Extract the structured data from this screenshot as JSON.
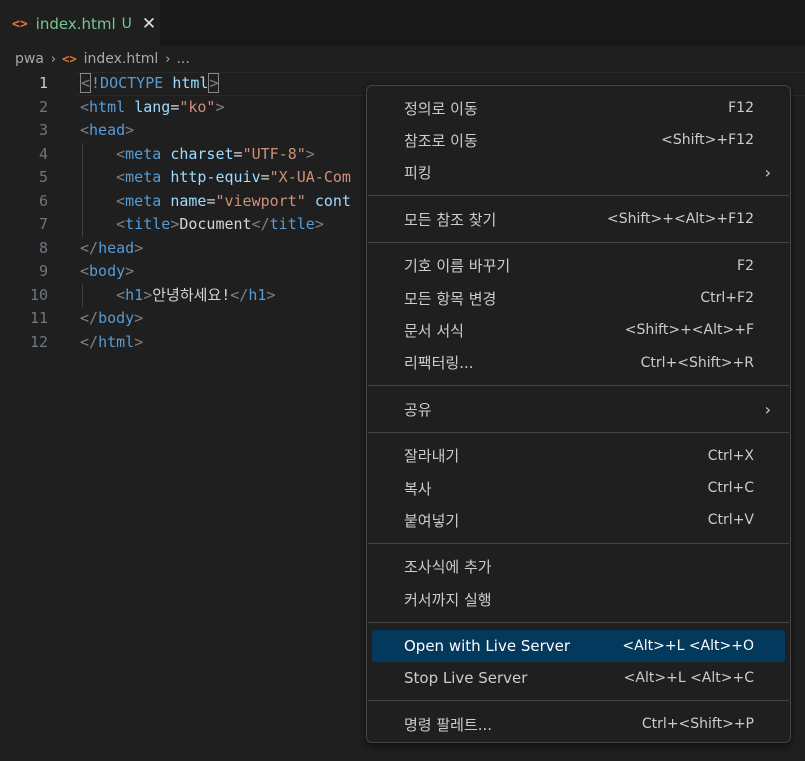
{
  "tab": {
    "title": "index.html",
    "status": "U",
    "close": "✕",
    "file_icon": "<>"
  },
  "breadcrumb": {
    "root": "pwa",
    "file": "index.html",
    "more": "...",
    "sep": "›"
  },
  "editor": {
    "current_line": 1,
    "lines": [
      {
        "n": "1",
        "tokens": [
          [
            "<",
            "punc-box"
          ],
          [
            "!DOCTYPE",
            "tag"
          ],
          [
            " ",
            "text"
          ],
          [
            "html",
            "attr"
          ],
          [
            ">",
            "punc-box"
          ]
        ]
      },
      {
        "n": "2",
        "tokens": [
          [
            "<",
            "punc"
          ],
          [
            "html",
            "tag"
          ],
          [
            " ",
            "text"
          ],
          [
            "lang",
            "attr"
          ],
          [
            "=",
            "text"
          ],
          [
            "\"ko\"",
            "str"
          ],
          [
            ">",
            "punc"
          ]
        ]
      },
      {
        "n": "3",
        "tokens": [
          [
            "<",
            "punc"
          ],
          [
            "head",
            "tag"
          ],
          [
            ">",
            "punc"
          ]
        ]
      },
      {
        "n": "4",
        "tokens": [
          [
            "    ",
            "text"
          ],
          [
            "<",
            "punc"
          ],
          [
            "meta",
            "tag"
          ],
          [
            " ",
            "text"
          ],
          [
            "charset",
            "attr"
          ],
          [
            "=",
            "text"
          ],
          [
            "\"UTF-8\"",
            "str"
          ],
          [
            ">",
            "punc"
          ]
        ]
      },
      {
        "n": "5",
        "tokens": [
          [
            "    ",
            "text"
          ],
          [
            "<",
            "punc"
          ],
          [
            "meta",
            "tag"
          ],
          [
            " ",
            "text"
          ],
          [
            "http-equiv",
            "attr"
          ],
          [
            "=",
            "text"
          ],
          [
            "\"X-UA-Com",
            "str"
          ]
        ]
      },
      {
        "n": "6",
        "tokens": [
          [
            "    ",
            "text"
          ],
          [
            "<",
            "punc"
          ],
          [
            "meta",
            "tag"
          ],
          [
            " ",
            "text"
          ],
          [
            "name",
            "attr"
          ],
          [
            "=",
            "text"
          ],
          [
            "\"viewport\"",
            "str"
          ],
          [
            " ",
            "text"
          ],
          [
            "cont",
            "attr"
          ]
        ]
      },
      {
        "n": "7",
        "tokens": [
          [
            "    ",
            "text"
          ],
          [
            "<",
            "punc"
          ],
          [
            "title",
            "tag"
          ],
          [
            ">",
            "punc"
          ],
          [
            "Document",
            "text"
          ],
          [
            "</",
            "punc"
          ],
          [
            "title",
            "tag"
          ],
          [
            ">",
            "punc"
          ]
        ]
      },
      {
        "n": "8",
        "tokens": [
          [
            "</",
            "punc"
          ],
          [
            "head",
            "tag"
          ],
          [
            ">",
            "punc"
          ]
        ]
      },
      {
        "n": "9",
        "tokens": [
          [
            "<",
            "punc"
          ],
          [
            "body",
            "tag"
          ],
          [
            ">",
            "punc"
          ]
        ]
      },
      {
        "n": "10",
        "tokens": [
          [
            "    ",
            "text"
          ],
          [
            "<",
            "punc"
          ],
          [
            "h1",
            "tag"
          ],
          [
            ">",
            "punc"
          ],
          [
            "안녕하세요!",
            "text"
          ],
          [
            "</",
            "punc"
          ],
          [
            "h1",
            "tag"
          ],
          [
            ">",
            "punc"
          ]
        ]
      },
      {
        "n": "11",
        "tokens": [
          [
            "</",
            "punc"
          ],
          [
            "body",
            "tag"
          ],
          [
            ">",
            "punc"
          ]
        ]
      },
      {
        "n": "12",
        "tokens": [
          [
            "</",
            "punc"
          ],
          [
            "html",
            "tag"
          ],
          [
            ">",
            "punc"
          ]
        ]
      }
    ]
  },
  "menu": {
    "groups": [
      [
        {
          "label": "정의로 이동",
          "key": "F12"
        },
        {
          "label": "참조로 이동",
          "key": "<Shift>+F12"
        },
        {
          "label": "피킹",
          "submenu": true
        }
      ],
      [
        {
          "label": "모든 참조 찾기",
          "key": "<Shift>+<Alt>+F12"
        }
      ],
      [
        {
          "label": "기호 이름 바꾸기",
          "key": "F2"
        },
        {
          "label": "모든 항목 변경",
          "key": "Ctrl+F2"
        },
        {
          "label": "문서 서식",
          "key": "<Shift>+<Alt>+F"
        },
        {
          "label": "리팩터링...",
          "key": "Ctrl+<Shift>+R"
        }
      ],
      [
        {
          "label": "공유",
          "submenu": true
        }
      ],
      [
        {
          "label": "잘라내기",
          "key": "Ctrl+X"
        },
        {
          "label": "복사",
          "key": "Ctrl+C"
        },
        {
          "label": "붙여넣기",
          "key": "Ctrl+V"
        }
      ],
      [
        {
          "label": "조사식에 추가"
        },
        {
          "label": "커서까지 실행"
        }
      ],
      [
        {
          "label": "Open with Live Server",
          "key": "<Alt>+L <Alt>+O",
          "active": true
        },
        {
          "label": "Stop Live Server",
          "key": "<Alt>+L <Alt>+C"
        }
      ],
      [
        {
          "label": "명령 팔레트...",
          "key": "Ctrl+<Shift>+P"
        }
      ]
    ],
    "submenu_arrow": "›"
  },
  "colors": {
    "background": "#1f1f1f",
    "tab_modified": "#73c991",
    "html_icon": "#e37933",
    "menu_active": "#04395e",
    "tag": "#569cd6",
    "attribute": "#9cdcfe",
    "string": "#ce9178"
  }
}
